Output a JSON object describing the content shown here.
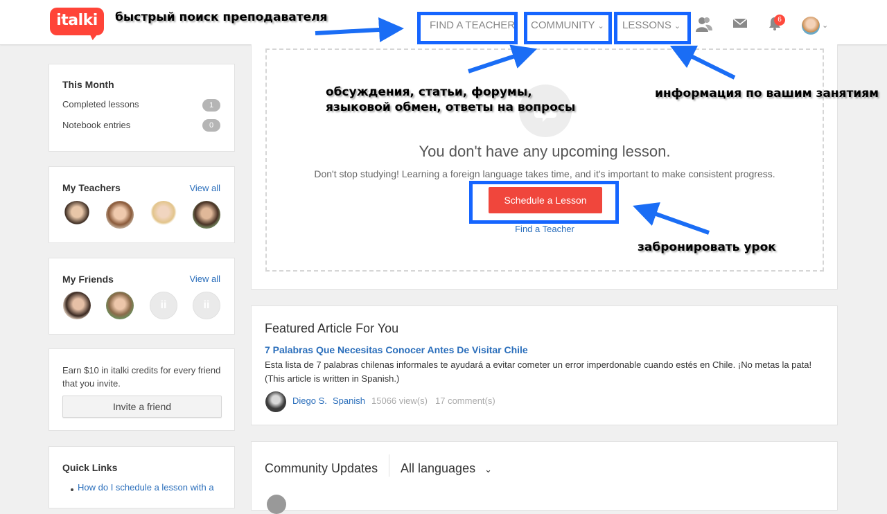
{
  "header": {
    "logo_text": "italki",
    "nav": {
      "find_teacher": "FIND A TEACHER",
      "community": "COMMUNITY",
      "lessons": "LESSONS"
    },
    "notification_count": "6",
    "icons": [
      "people-icon",
      "mail-icon",
      "bell-icon",
      "avatar",
      "chevron-down-icon"
    ]
  },
  "annotations": {
    "find_teacher": "быстрый поиск преподавателя",
    "community_line1": "обсуждения, статьи, форумы,",
    "community_line2": "языковой обмен, ответы на вопросы",
    "lessons": "информация по вашим занятиям",
    "schedule": "забронировать урок",
    "highlight_color": "#1565ff"
  },
  "sidebar": {
    "this_month": {
      "title": "This Month",
      "rows": [
        {
          "label": "Completed lessons",
          "count": "1"
        },
        {
          "label": "Notebook entries",
          "count": "0"
        }
      ]
    },
    "my_teachers": {
      "title": "My Teachers",
      "view_all": "View all"
    },
    "my_friends": {
      "title": "My Friends",
      "view_all": "View all"
    },
    "invite": {
      "text_line1": "Earn $10 in italki credits for every friend",
      "text_line2": "that you invite.",
      "button": "Invite a friend"
    },
    "quick_links": {
      "title": "Quick Links",
      "first_link": "How do I schedule a lesson with a"
    }
  },
  "main": {
    "upcoming": {
      "heading": "You don't have any upcoming lesson.",
      "subtext": "Don't stop studying! Learning a foreign language takes time, and it's important to make consistent progress.",
      "schedule_button": "Schedule a Lesson",
      "find_teacher_link": "Find a Teacher",
      "accent_color": "#f0463c"
    },
    "featured": {
      "heading": "Featured Article For You",
      "title": "7 Palabras Que Necesitas Conocer Antes De Visitar Chile",
      "body_line1": "Esta lista de 7 palabras chilenas informales te ayudará a evitar cometer un error imperdonable cuando estés en Chile. ¡No metas la pata!",
      "body_line2": "(This article is written in Spanish.)",
      "author": "Diego S.",
      "language": "Spanish",
      "views": "15066 view(s)",
      "comments": "17 comment(s)"
    },
    "community": {
      "heading": "Community Updates",
      "language_filter": "All languages"
    }
  }
}
